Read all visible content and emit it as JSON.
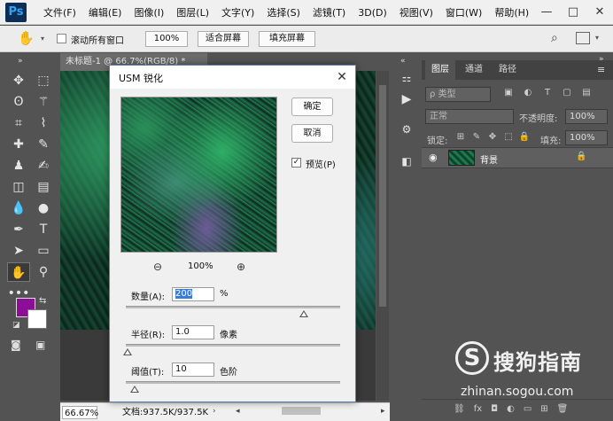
{
  "app": {
    "logo": "Ps",
    "menu": [
      "文件(F)",
      "编辑(E)",
      "图像(I)",
      "图层(L)",
      "文字(Y)",
      "选择(S)",
      "滤镜(T)",
      "3D(D)",
      "视图(V)",
      "窗口(W)",
      "帮助(H)"
    ],
    "window_buttons": [
      "—",
      "□",
      "✕"
    ]
  },
  "options_bar": {
    "scroll_all_label": "滚动所有窗口",
    "zoom_label": "100%",
    "fit_screen_label": "适合屏幕",
    "fill_screen_label": "填充屏幕"
  },
  "document": {
    "tab_title": "未标题-1 @ 66.7%(RGB/8) *",
    "status_zoom": "66.67%",
    "status_doc": "文档:937.5K/937.5K"
  },
  "layers_panel": {
    "tabs": [
      "图层",
      "通道",
      "路径"
    ],
    "active_tab": 0,
    "kind_placeholder": "ρ 类型",
    "blend_mode": "正常",
    "opacity_label": "不透明度:",
    "opacity_value": "100%",
    "lock_label": "锁定:",
    "fill_label": "填充:",
    "fill_value": "100%",
    "layers": [
      {
        "name": "背景",
        "locked": true,
        "visible": true
      }
    ],
    "bottom_icons": [
      "link-icon",
      "fx-icon",
      "mask-icon",
      "adjust-icon",
      "folder-icon",
      "new-layer-icon",
      "trash-icon"
    ]
  },
  "dialog": {
    "title": "USM 锐化",
    "ok_label": "确定",
    "cancel_label": "取消",
    "preview_label": "预览(P)",
    "preview_checked": true,
    "zoom_percent": "100%",
    "params": [
      {
        "label": "数量(A):",
        "value": "200",
        "unit": "%",
        "slider_fraction": 0.83
      },
      {
        "label": "半径(R):",
        "value": "1.0",
        "unit": "像素",
        "slider_fraction": 0.01
      },
      {
        "label": "阈值(T):",
        "value": "10",
        "unit": "色阶",
        "slider_fraction": 0.04
      }
    ]
  },
  "watermark": {
    "symbol": "S",
    "text": "搜狗指南",
    "url": "zhinan.sogou.com"
  },
  "colors": {
    "foreground": "#8c0d96",
    "background": "#ffffff"
  }
}
